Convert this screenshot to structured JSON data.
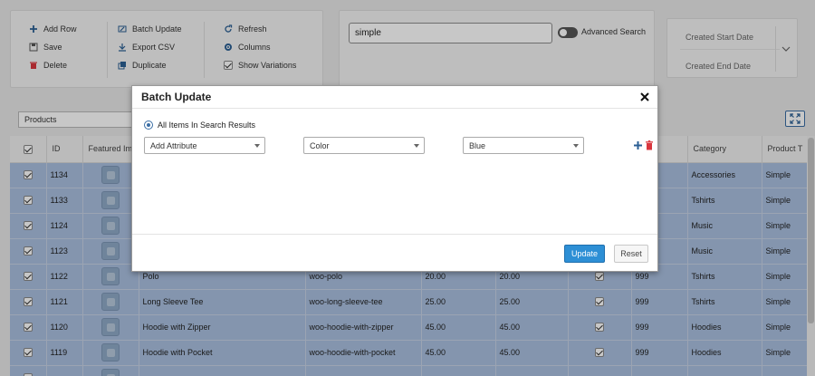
{
  "toolbar": {
    "add_row": "Add Row",
    "save": "Save",
    "delete": "Delete",
    "batch_update": "Batch Update",
    "export_csv": "Export CSV",
    "duplicate": "Duplicate",
    "refresh": "Refresh",
    "columns": "Columns",
    "show_variations": "Show Variations"
  },
  "search": {
    "value": "simple",
    "advanced_label": "Advanced Search"
  },
  "dates": {
    "start_label": "Created Start Date",
    "end_label": "Created End Date"
  },
  "filter": {
    "selected": "Products"
  },
  "table": {
    "headers": [
      "",
      "ID",
      "Featured Im",
      "",
      "",
      "",
      "",
      "",
      "",
      "Category",
      "Product T"
    ],
    "rows": [
      {
        "id": "1134",
        "name": "",
        "sku": "",
        "price": "",
        "sale": "",
        "stock": "",
        "category": "Accessories",
        "type": "Simple"
      },
      {
        "id": "1133",
        "name": "",
        "sku": "",
        "price": "",
        "sale": "",
        "stock": "",
        "category": "Tshirts",
        "type": "Simple"
      },
      {
        "id": "1124",
        "name": "",
        "sku": "",
        "price": "",
        "sale": "",
        "stock": "",
        "category": "Music",
        "type": "Simple"
      },
      {
        "id": "1123",
        "name": "",
        "sku": "",
        "price": "",
        "sale": "",
        "stock": "",
        "category": "Music",
        "type": "Simple"
      },
      {
        "id": "1122",
        "name": "Polo",
        "sku": "woo-polo",
        "price": "20.00",
        "sale": "20.00",
        "stock": "999",
        "category": "Tshirts",
        "type": "Simple"
      },
      {
        "id": "1121",
        "name": "Long Sleeve Tee",
        "sku": "woo-long-sleeve-tee",
        "price": "25.00",
        "sale": "25.00",
        "stock": "999",
        "category": "Tshirts",
        "type": "Simple"
      },
      {
        "id": "1120",
        "name": "Hoodie with Zipper",
        "sku": "woo-hoodie-with-zipper",
        "price": "45.00",
        "sale": "45.00",
        "stock": "999",
        "category": "Hoodies",
        "type": "Simple"
      },
      {
        "id": "1119",
        "name": "Hoodie with Pocket",
        "sku": "woo-hoodie-with-pocket",
        "price": "45.00",
        "sale": "45.00",
        "stock": "999",
        "category": "Hoodies",
        "type": "Simple"
      },
      {
        "id": "",
        "name": "",
        "sku": "",
        "price": "",
        "sale": "",
        "stock": "",
        "category": "",
        "type": ""
      }
    ]
  },
  "modal": {
    "title": "Batch Update",
    "radio_label": "All Items In Search Results",
    "select1": "Add Attribute",
    "select2": "Color",
    "select3": "Blue",
    "update_label": "Update",
    "reset_label": "Reset"
  },
  "colors": {
    "accent": "#2d8fd5",
    "row_selected": "#a9bfdf",
    "delete_red": "#d9363e"
  }
}
